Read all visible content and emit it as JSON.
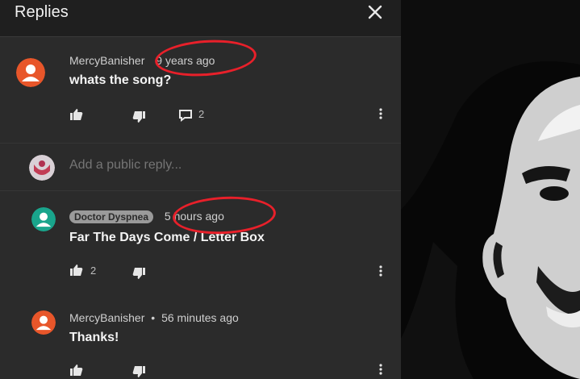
{
  "header": {
    "title": "Replies",
    "close_icon": "close-icon"
  },
  "comments": [
    {
      "author": "MercyBanisher",
      "time": "9 years ago",
      "text": "whats the song?",
      "reply_count": "2",
      "avatar_color": "#e8562a"
    },
    {
      "author": "Doctor Dyspnea",
      "time": "5 hours ago",
      "text": "Far The Days Come / Letter Box",
      "like_count": "2",
      "avatar_color": "#19a58c"
    },
    {
      "author": "MercyBanisher",
      "separator": "•",
      "time": "56 minutes ago",
      "text": "Thanks!",
      "avatar_color": "#e8562a"
    }
  ],
  "reply_box": {
    "placeholder": "Add a public reply..."
  },
  "colors": {
    "highlight": "#e8202a",
    "panel_bg": "#2b2b2b",
    "header_bg": "#1f1f1f"
  }
}
